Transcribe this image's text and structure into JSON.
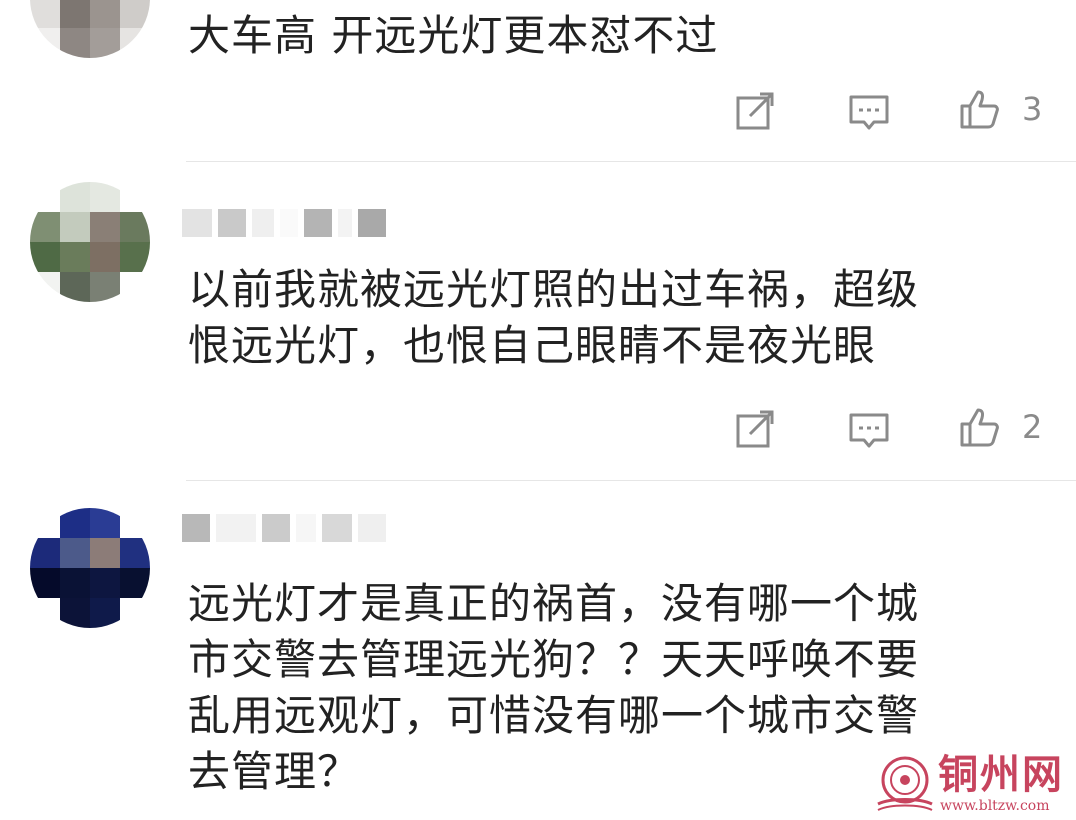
{
  "comments": [
    {
      "text": "大车高 开远光灯更本怼不过",
      "likes": "3",
      "icons": {
        "share": "share-edit-icon",
        "reply": "comment-bubble-icon",
        "like": "thumbs-up-icon"
      }
    },
    {
      "text": "以前我就被远光灯照的出过车祸，超级\n恨远光灯，也恨自己眼睛不是夜光眼",
      "likes": "2",
      "icons": {
        "share": "share-edit-icon",
        "reply": "comment-bubble-icon",
        "like": "thumbs-up-icon"
      }
    },
    {
      "text": "远光灯才是真正的祸首，没有哪一个城\n市交警去管理远光狗？？天天呼唤不要\n乱用远观灯，可惜没有哪一个城市交警\n去管理？"
    }
  ],
  "watermark": {
    "name": "铜州网",
    "url": "www.bltzw.com"
  },
  "colors": {
    "text": "#222222",
    "icon": "#8a8a8a",
    "divider": "#e6e6e6",
    "watermark": "#c7445e"
  }
}
